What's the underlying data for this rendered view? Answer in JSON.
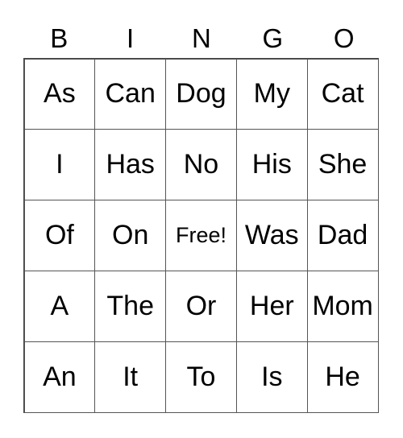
{
  "header": [
    "B",
    "I",
    "N",
    "G",
    "O"
  ],
  "cells": [
    [
      "As",
      "Can",
      "Dog",
      "My",
      "Cat"
    ],
    [
      "I",
      "Has",
      "No",
      "His",
      "She"
    ],
    [
      "Of",
      "On",
      "Free!",
      "Was",
      "Dad"
    ],
    [
      "A",
      "The",
      "Or",
      "Her",
      "Mom"
    ],
    [
      "An",
      "It",
      "To",
      "Is",
      "He"
    ]
  ],
  "free_cell": "Free!"
}
